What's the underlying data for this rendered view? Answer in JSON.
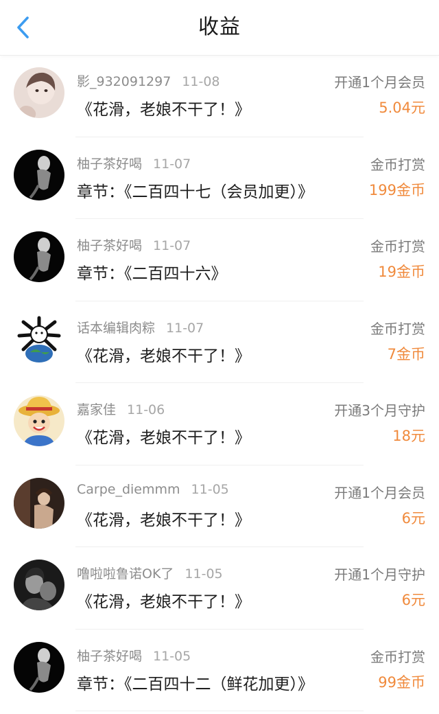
{
  "header": {
    "title": "收益",
    "back_icon": "chevron-left-icon",
    "accent_color": "#3c9cf0"
  },
  "income_color": "#f08a3c",
  "records": [
    {
      "user": "影_932091297",
      "date": "11-08",
      "work": "《花滑，老娘不干了！》",
      "type": "开通1个月会员",
      "amount": "5.04元"
    },
    {
      "user": "柚子茶好喝",
      "date": "11-07",
      "work": "章节：《二百四十七（会员加更）》",
      "type": "金币打赏",
      "amount": "199金币"
    },
    {
      "user": "柚子茶好喝",
      "date": "11-07",
      "work": "章节：《二百四十六》",
      "type": "金币打赏",
      "amount": "19金币"
    },
    {
      "user": "话本编辑肉粽",
      "date": "11-07",
      "work": "《花滑，老娘不干了！》",
      "type": "金币打赏",
      "amount": "7金币"
    },
    {
      "user": "嘉家佳",
      "date": "11-06",
      "work": "《花滑，老娘不干了！》",
      "type": "开通3个月守护",
      "amount": "18元"
    },
    {
      "user": "Carpe_diemmm",
      "date": "11-05",
      "work": "《花滑，老娘不干了！》",
      "type": "开通1个月会员",
      "amount": "6元"
    },
    {
      "user": "噜啦啦鲁诺OK了",
      "date": "11-05",
      "work": "《花滑，老娘不干了！》",
      "type": "开通1个月守护",
      "amount": "6元"
    },
    {
      "user": "柚子茶好喝",
      "date": "11-05",
      "work": "章节：《二百四十二（鲜花加更）》",
      "type": "金币打赏",
      "amount": "99金币"
    }
  ]
}
